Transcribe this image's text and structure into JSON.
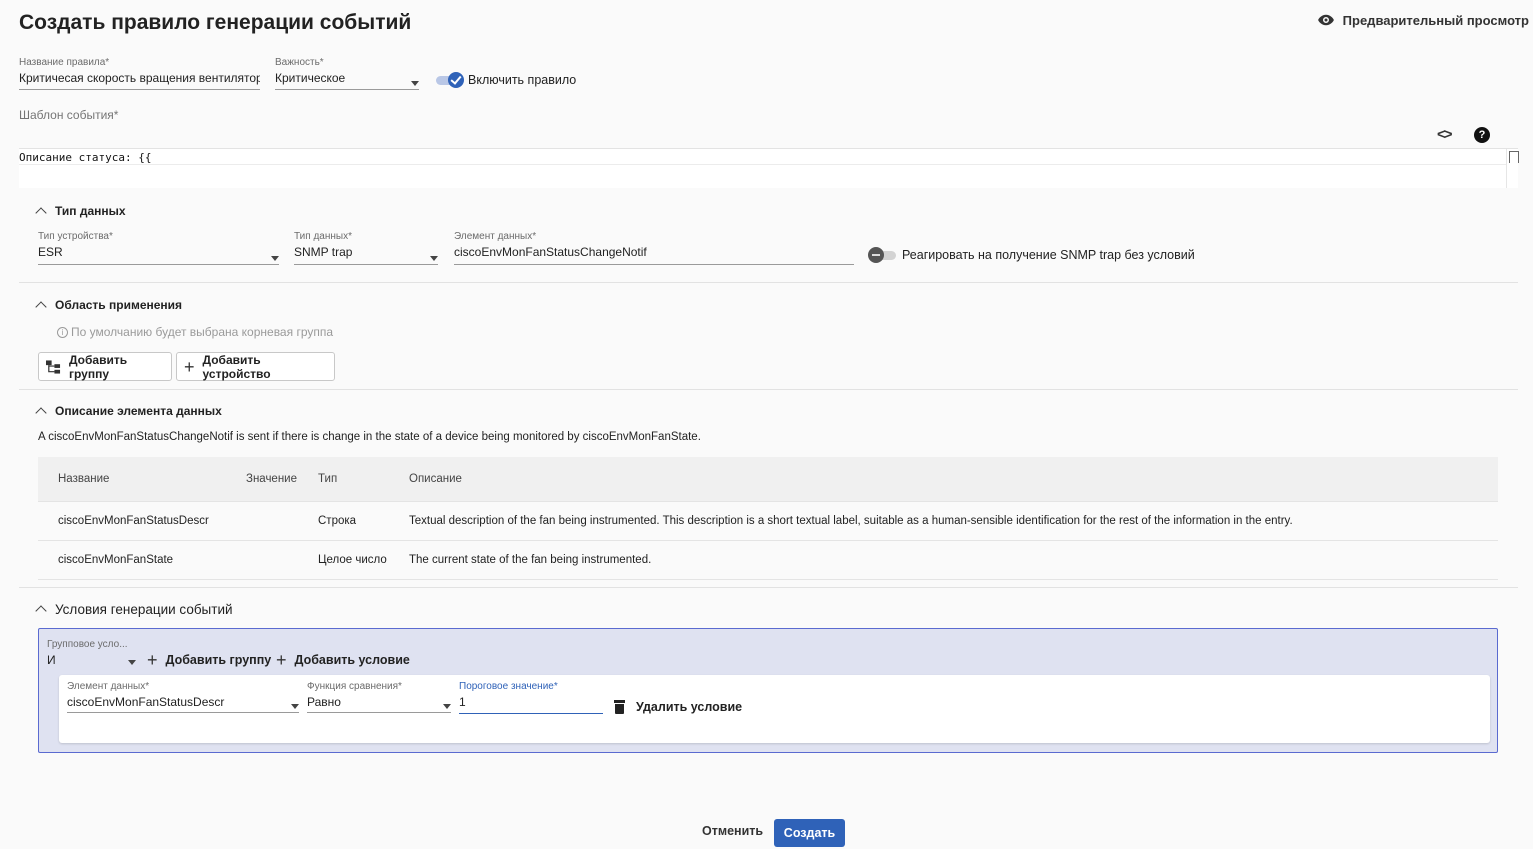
{
  "page": {
    "title": "Создать правило генерации событий",
    "preview_label": "Предварительный просмотр"
  },
  "rule": {
    "name_label": "Название правила*",
    "name_value": "Критичесая скорость вращения вентилятор",
    "severity_label": "Важность*",
    "severity_value": "Критическое",
    "enable_label": "Включить правило",
    "enabled": true
  },
  "template": {
    "label": "Шаблон события*",
    "code": "Описание статуса: {{"
  },
  "data_type_section": {
    "title": "Тип данных",
    "device_type_label": "Тип устройства*",
    "device_type_value": "ESR",
    "data_type_label": "Тип данных*",
    "data_type_value": "SNMP trap",
    "data_element_label": "Элемент данных*",
    "data_element_value": "ciscoEnvMonFanStatusChangeNotif",
    "unconditional_label": "Реагировать на получение SNMP trap без условий",
    "unconditional": false
  },
  "scope_section": {
    "title": "Область применения",
    "hint": "По умолчанию будет выбрана корневая группа",
    "add_group_label": "Добавить группу",
    "add_device_label": "Добавить устройство"
  },
  "element_desc_section": {
    "title": "Описание элемента данных",
    "description": "A ciscoEnvMonFanStatusChangeNotif is sent if there is change in the state of a device being monitored by ciscoEnvMonFanState.",
    "columns": [
      "Название",
      "Значение",
      "Тип",
      "Описание"
    ],
    "rows": [
      {
        "name": "ciscoEnvMonFanStatusDescr",
        "value": "",
        "type": "Строка",
        "description": "Textual description of the fan being instrumented. This description is a short textual label, suitable as a human-sensible identification for the rest of the information in the entry."
      },
      {
        "name": "ciscoEnvMonFanState",
        "value": "",
        "type": "Целое число",
        "description": "The current state of the fan being instrumented."
      }
    ]
  },
  "conditions_section": {
    "title": "Условия генерации событий",
    "group_condition_label": "Групповое усло...",
    "group_condition_value": "И",
    "add_group_label": "Добавить группу",
    "add_condition_label": "Добавить условие",
    "condition": {
      "element_label": "Элемент данных*",
      "element_value": "ciscoEnvMonFanStatusDescr",
      "compare_label": "Функция сравнения*",
      "compare_value": "Равно",
      "threshold_label": "Пороговое значение*",
      "threshold_value": "1",
      "delete_label": "Удалить условие"
    }
  },
  "footer": {
    "cancel_label": "Отменить",
    "create_label": "Создать"
  },
  "colors": {
    "accent": "#2f62b8",
    "group_bg": "#dfe2f1",
    "group_border": "#5a6ad0"
  }
}
